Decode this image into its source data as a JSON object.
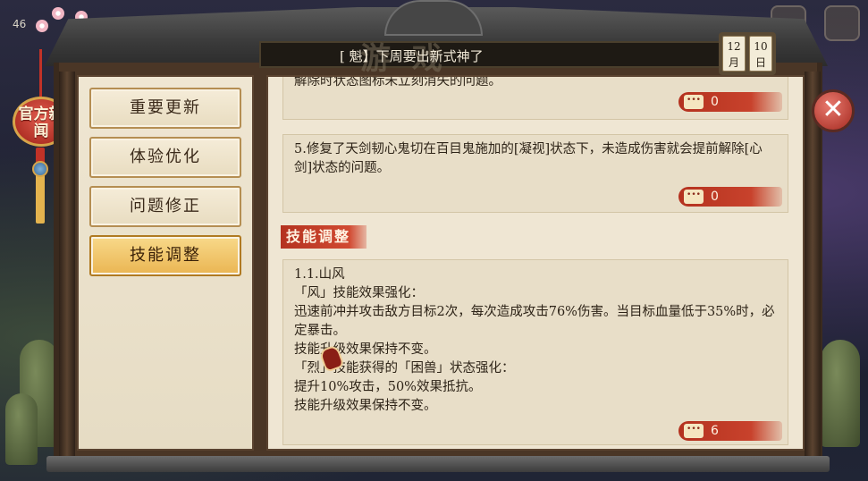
{
  "status": {
    "counter": "46"
  },
  "news_lantern": {
    "label": "官方新闻"
  },
  "header": {
    "watermark": "游 戏",
    "title": "[          魁】下周要出新式神了",
    "calendar": {
      "month": "12\n月",
      "day": "10\n日"
    }
  },
  "close_icon": "✕",
  "sidebar": {
    "items": [
      {
        "label": "重要更新",
        "active": false
      },
      {
        "label": "体验优化",
        "active": false
      },
      {
        "label": "问题修正",
        "active": false
      },
      {
        "label": "技能调整",
        "active": true
      }
    ]
  },
  "content": {
    "cards": [
      {
        "text": "解除时状态图标未立刻消失的问题。",
        "comments": "0"
      },
      {
        "text": "5.修复了天剑韧心鬼切在百目鬼施加的[凝视]状态下，未造成伤害就会提前解除[心剑]状态的问题。",
        "comments": "0"
      }
    ],
    "section_title": "技能调整",
    "skill_card": {
      "lines": [
        "1.1.山风",
        "「风」技能效果强化：",
        "迅速前冲并攻击敌方目标2次，每次造成攻击76%伤害。当目标血量低于35%时，必定暴击。",
        "技能升级效果保持不变。",
        "「烈」技能获得的「困兽」状态强化：",
        "提升10%攻击，50%效果抵抗。",
        "技能升级效果保持不变。"
      ],
      "comments": "6"
    }
  },
  "colors": {
    "accent_red": "#b4321f",
    "active_tab": "#eab552",
    "parchment": "#efe6d3"
  },
  "icons": [
    "comment-icon",
    "close-icon",
    "calendar-icon",
    "chat-icon"
  ]
}
